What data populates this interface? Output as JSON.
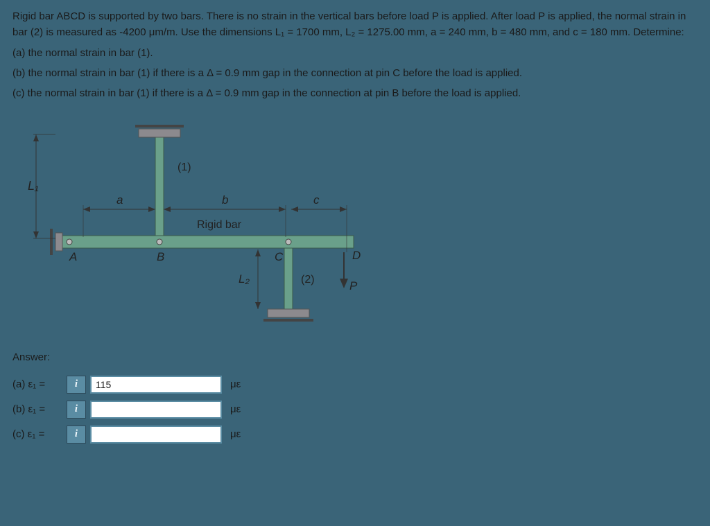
{
  "problem": {
    "intro": "Rigid bar ABCD is supported by two bars. There is no strain in the vertical bars before load P is applied. After load P is applied, the normal strain in bar (2) is measured as -4200 μm/m. Use the dimensions L₁ = 1700 mm, L₂ = 1275.00 mm, a = 240 mm, b = 480 mm, and c = 180 mm. Determine:",
    "a": "(a) the normal strain in bar (1).",
    "b": "(b) the normal strain in bar (1) if there is a Δ = 0.9 mm gap in the connection at pin C before the load is applied.",
    "c": "(c) the normal strain in bar (1) if there is a Δ = 0.9 mm gap in the connection at pin B before the load is applied."
  },
  "diagram": {
    "L1": "L₁",
    "L2": "L₂",
    "a": "a",
    "b": "b",
    "c": "c",
    "rigid": "Rigid bar",
    "A": "A",
    "B": "B",
    "C": "C",
    "D": "D",
    "one": "(1)",
    "two": "(2)",
    "P": "P"
  },
  "answer": {
    "heading": "Answer:",
    "rows": {
      "a": {
        "label": "(a) ε₁ =",
        "value": "115",
        "unit": "με"
      },
      "b": {
        "label": "(b) ε₁ =",
        "value": "",
        "unit": "με"
      },
      "c": {
        "label": "(c) ε₁ =",
        "value": "",
        "unit": "με"
      }
    },
    "info": "i"
  }
}
